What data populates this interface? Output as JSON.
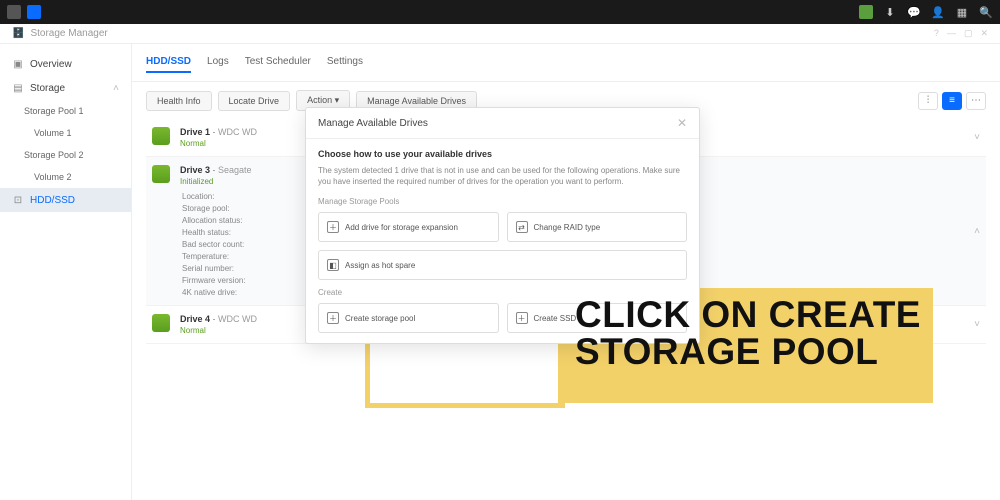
{
  "topbar": {
    "app_title": "Storage Manager"
  },
  "sidebar": {
    "items": [
      {
        "label": "Overview"
      },
      {
        "label": "Storage"
      },
      {
        "label": "Storage Pool 1"
      },
      {
        "label": "Volume 1"
      },
      {
        "label": "Storage Pool 2"
      },
      {
        "label": "Volume 2"
      },
      {
        "label": "HDD/SSD"
      }
    ]
  },
  "tabs": [
    {
      "label": "HDD/SSD"
    },
    {
      "label": "Logs"
    },
    {
      "label": "Test Scheduler"
    },
    {
      "label": "Settings"
    }
  ],
  "toolbar": {
    "health": "Health Info",
    "locate": "Locate Drive",
    "action": "Action ▾",
    "manage": "Manage Available Drives"
  },
  "drives": [
    {
      "name": "Drive 1",
      "model": "WDC WD",
      "status": "Normal"
    },
    {
      "name": "Drive 3",
      "model": "Seagate",
      "status": "Initialized",
      "fields": [
        "Location:",
        "Storage pool:",
        "Allocation status:",
        "Health status:",
        "Bad sector count:",
        "Temperature:",
        "Serial number:",
        "Firmware version:",
        "4K native drive:"
      ]
    },
    {
      "name": "Drive 4",
      "model": "WDC WD",
      "status": "Normal"
    }
  ],
  "modal": {
    "title": "Manage Available Drives",
    "subtitle": "Choose how to use your available drives",
    "description": "The system detected 1 drive that is not in use and can be used for the following operations. Make sure you have inserted the required number of drives for the operation you want to perform.",
    "section1": "Manage Storage Pools",
    "opt_expand": "Add drive for storage expansion",
    "opt_raid": "Change RAID type",
    "opt_spare": "Assign as hot spare",
    "section2": "Create",
    "opt_pool": "Create storage pool",
    "opt_ssd": "Create SSD"
  },
  "annotation": {
    "text": "CLICK ON CREATE STORAGE POOL"
  }
}
